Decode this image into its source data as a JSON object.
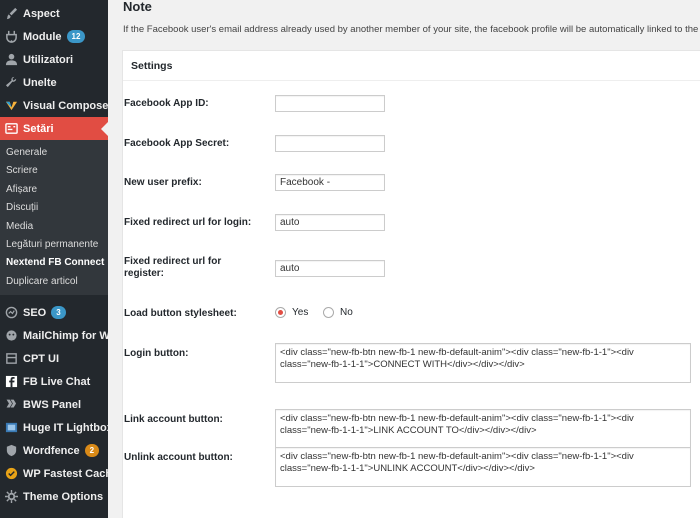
{
  "sidebar": {
    "items_top": [
      {
        "label": "Aspect",
        "icon": "brush-icon"
      },
      {
        "label": "Module",
        "icon": "plugin-icon",
        "badge": "12"
      },
      {
        "label": "Utilizatori",
        "icon": "user-icon"
      },
      {
        "label": "Unelte",
        "icon": "wrench-icon"
      },
      {
        "label": "Visual Composer",
        "icon": "visual-composer-icon"
      },
      {
        "label": "Setări",
        "icon": "settings-icon"
      }
    ],
    "submenu": [
      "Generale",
      "Scriere",
      "Afișare",
      "Discuții",
      "Media",
      "Legături permanente",
      "Nextend FB Connect",
      "Duplicare articol"
    ],
    "items_bottom": [
      {
        "label": "SEO",
        "icon": "seo-icon",
        "badge": "3"
      },
      {
        "label": "MailChimp for WP",
        "icon": "mailchimp-icon"
      },
      {
        "label": "CPT UI",
        "icon": "cpt-icon"
      },
      {
        "label": "FB Live Chat",
        "icon": "fb-chat-icon"
      },
      {
        "label": "BWS Panel",
        "icon": "bws-icon"
      },
      {
        "label": "Huge IT Lightbox",
        "icon": "lightbox-icon"
      },
      {
        "label": "Wordfence",
        "icon": "wordfence-icon",
        "badge": "2"
      },
      {
        "label": "WP Fastest Cache",
        "icon": "cache-icon"
      },
      {
        "label": "Theme Options",
        "icon": "theme-options-icon"
      }
    ]
  },
  "note": {
    "title": "Note",
    "text": "If the Facebook user's email address already used by another member of your site, the facebook profile will be automatically linked to the"
  },
  "settings": {
    "header": "Settings",
    "app_id_label": "Facebook App ID:",
    "app_id_value": "",
    "app_secret_label": "Facebook App Secret:",
    "app_secret_value": "",
    "prefix_label": "New user prefix:",
    "prefix_value": "Facebook -",
    "redirect_login_label": "Fixed redirect url for login:",
    "redirect_login_value": "auto",
    "redirect_register_label": "Fixed redirect url for register:",
    "redirect_register_value": "auto",
    "stylesheet_label": "Load button stylesheet:",
    "stylesheet_yes": "Yes",
    "stylesheet_no": "No",
    "login_button_label": "Login button:",
    "login_button_value": "<div class=\"new-fb-btn new-fb-1 new-fb-default-anim\"><div class=\"new-fb-1-1\"><div class=\"new-fb-1-1-1\">CONNECT WITH</div></div></div>",
    "link_button_label": "Link account button:",
    "link_button_value": "<div class=\"new-fb-btn new-fb-1 new-fb-default-anim\"><div class=\"new-fb-1-1\"><div class=\"new-fb-1-1-1\">LINK ACCOUNT TO</div></div></div>",
    "unlink_button_label": "Unlink account button:",
    "unlink_button_value": "<div class=\"new-fb-btn new-fb-1 new-fb-default-anim\"><div class=\"new-fb-1-1\"><div class=\"new-fb-1-1-1\">UNLINK ACCOUNT</div></div></div>"
  },
  "colors": {
    "sidebar_bg": "#23282d",
    "submenu_bg": "#32373c",
    "active": "#e14d43",
    "badge_blue": "#3b97c8",
    "badge_orange": "#d98a18"
  }
}
